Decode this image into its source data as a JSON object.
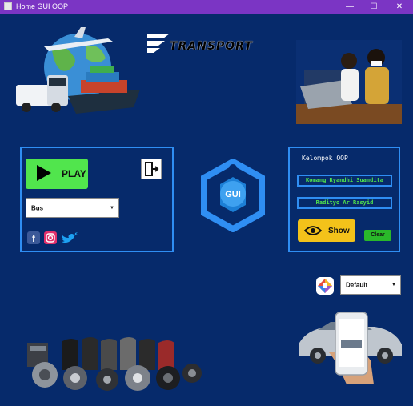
{
  "window": {
    "title": "Home GUI OOP",
    "minimize_glyph": "—",
    "maximize_glyph": "☐",
    "close_glyph": "✕"
  },
  "header": {
    "logo_text": "TRANSPORT"
  },
  "left_panel": {
    "play_label": "PLAY",
    "vehicle_select_value": "Bus",
    "social": [
      "facebook-icon",
      "instagram-icon",
      "twitter-icon"
    ]
  },
  "center_logo": {
    "label": "GUI"
  },
  "right_panel": {
    "group_title": "Kelompok OOP",
    "members": [
      "Komang Ryandhi Suandita",
      "Radityo Ar Rasyid"
    ],
    "show_label": "Show",
    "clear_label": "Clear"
  },
  "theme": {
    "select_value": "Default"
  },
  "colors": {
    "background": "#062a6b",
    "titlebar": "#7b35c4",
    "panel_border": "#2f8ef3",
    "play_green": "#51e54d",
    "show_yellow": "#f3c21a",
    "clear_green": "#2ab82a",
    "member_text": "#51e54d"
  }
}
